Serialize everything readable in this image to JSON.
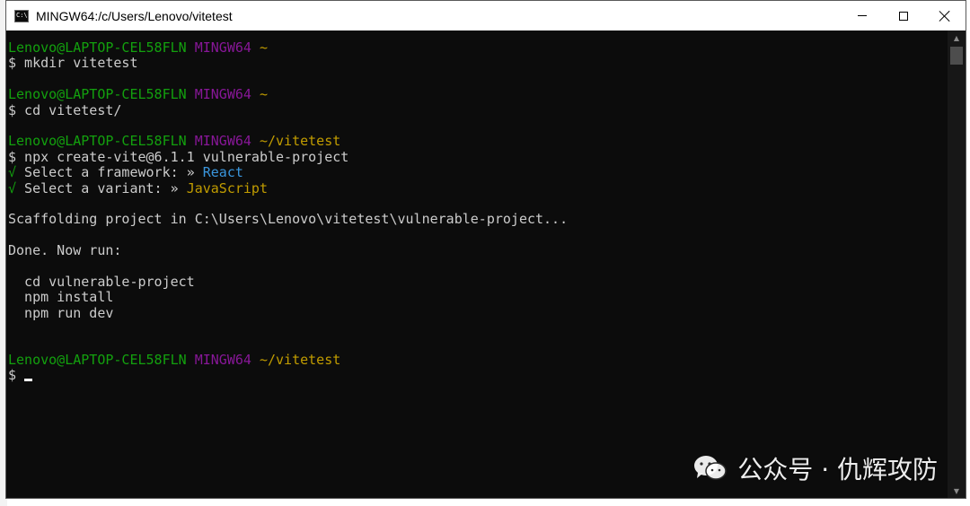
{
  "window": {
    "title": "MINGW64:/c/Users/Lenovo/vitetest",
    "controls": [
      "minimize",
      "maximize",
      "close"
    ]
  },
  "terminal": {
    "lines": [
      {
        "segments": [
          {
            "text": "Lenovo@LAPTOP-CEL58FLN",
            "color": "green"
          },
          {
            "text": " "
          },
          {
            "text": "MINGW64",
            "color": "magenta"
          },
          {
            "text": " "
          },
          {
            "text": "~",
            "color": "yellow"
          }
        ]
      },
      {
        "segments": [
          {
            "text": "$ mkdir vitetest"
          }
        ]
      },
      {
        "segments": [
          {
            "text": ""
          }
        ]
      },
      {
        "segments": [
          {
            "text": "Lenovo@LAPTOP-CEL58FLN",
            "color": "green"
          },
          {
            "text": " "
          },
          {
            "text": "MINGW64",
            "color": "magenta"
          },
          {
            "text": " "
          },
          {
            "text": "~",
            "color": "yellow"
          }
        ]
      },
      {
        "segments": [
          {
            "text": "$ cd vitetest/"
          }
        ]
      },
      {
        "segments": [
          {
            "text": ""
          }
        ]
      },
      {
        "segments": [
          {
            "text": "Lenovo@LAPTOP-CEL58FLN",
            "color": "green"
          },
          {
            "text": " "
          },
          {
            "text": "MINGW64",
            "color": "magenta"
          },
          {
            "text": " "
          },
          {
            "text": "~/vitetest",
            "color": "yellow"
          }
        ]
      },
      {
        "segments": [
          {
            "text": "$ npx create-vite@6.1.1 vulnerable-project"
          }
        ]
      },
      {
        "segments": [
          {
            "text": "√",
            "color": "green"
          },
          {
            "text": " Select a framework: "
          },
          {
            "text": "» ",
            "color": "dim"
          },
          {
            "text": "React",
            "color": "cyan"
          }
        ]
      },
      {
        "segments": [
          {
            "text": "√",
            "color": "green"
          },
          {
            "text": " Select a variant: "
          },
          {
            "text": "» ",
            "color": "dim"
          },
          {
            "text": "JavaScript",
            "color": "yellow"
          }
        ]
      },
      {
        "segments": [
          {
            "text": ""
          }
        ]
      },
      {
        "segments": [
          {
            "text": "Scaffolding project in C:\\Users\\Lenovo\\vitetest\\vulnerable-project..."
          }
        ]
      },
      {
        "segments": [
          {
            "text": ""
          }
        ]
      },
      {
        "segments": [
          {
            "text": "Done. Now run:"
          }
        ]
      },
      {
        "segments": [
          {
            "text": ""
          }
        ]
      },
      {
        "segments": [
          {
            "text": "  cd vulnerable-project"
          }
        ]
      },
      {
        "segments": [
          {
            "text": "  npm install"
          }
        ]
      },
      {
        "segments": [
          {
            "text": "  npm run dev"
          }
        ]
      },
      {
        "segments": [
          {
            "text": ""
          }
        ]
      },
      {
        "segments": [
          {
            "text": ""
          }
        ]
      },
      {
        "segments": [
          {
            "text": "Lenovo@LAPTOP-CEL58FLN",
            "color": "green"
          },
          {
            "text": " "
          },
          {
            "text": "MINGW64",
            "color": "magenta"
          },
          {
            "text": " "
          },
          {
            "text": "~/vitetest",
            "color": "yellow"
          }
        ]
      }
    ],
    "prompt_symbol": "$"
  },
  "watermark": {
    "logo_icon": "wechat-icon",
    "text": "公众号 · 仇辉攻防"
  },
  "colors": {
    "background": "#0c0c0c",
    "text": "#cccccc",
    "green": "#13a10e",
    "magenta": "#881798",
    "yellow": "#c19c00",
    "cyan": "#3a96dd"
  }
}
